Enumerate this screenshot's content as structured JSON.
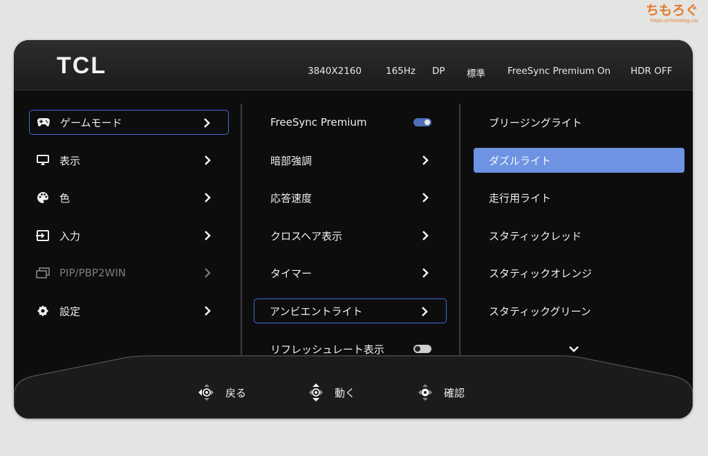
{
  "watermark": {
    "title": "ちもろぐ",
    "url": "https://chimolog.co/"
  },
  "header": {
    "logo": "TCL",
    "status": [
      "3840X2160",
      "165Hz",
      "DP",
      "標準",
      "FreeSync Premium On",
      "HDR OFF"
    ]
  },
  "main_menu": [
    {
      "label": "ゲームモード",
      "icon": "gamepad-icon",
      "selected": true
    },
    {
      "label": "表示",
      "icon": "display-icon"
    },
    {
      "label": "色",
      "icon": "palette-icon"
    },
    {
      "label": "入力",
      "icon": "input-icon"
    },
    {
      "label": "PIP/PBP2WIN",
      "icon": "pip-icon",
      "disabled": true
    },
    {
      "label": "設定",
      "icon": "gear-icon"
    }
  ],
  "game_menu": [
    {
      "label": "FreeSync Premium",
      "control": "toggle",
      "on": true
    },
    {
      "label": "暗部強調",
      "control": "chevron"
    },
    {
      "label": "応答速度",
      "control": "chevron"
    },
    {
      "label": "クロスヘア表示",
      "control": "chevron"
    },
    {
      "label": "タイマー",
      "control": "chevron"
    },
    {
      "label": "アンビエントライト",
      "control": "chevron",
      "selected": true
    },
    {
      "label": "リフレッシュレート表示",
      "control": "toggle",
      "on": false
    }
  ],
  "ambient_options": [
    {
      "label": "ブリージングライト"
    },
    {
      "label": "ダズルライト",
      "highlighted": true
    },
    {
      "label": "走行用ライト"
    },
    {
      "label": "スタティックレッド"
    },
    {
      "label": "スタティックオレンジ"
    },
    {
      "label": "スタティックグリーン"
    }
  ],
  "more_indicator_icon": "chevron-down-icon",
  "footer": {
    "back": "戻る",
    "move": "動く",
    "confirm": "確認"
  },
  "colors": {
    "accent": "#3f6ed8",
    "highlight": "#6d93e2",
    "watermark": "#e27a2e"
  }
}
